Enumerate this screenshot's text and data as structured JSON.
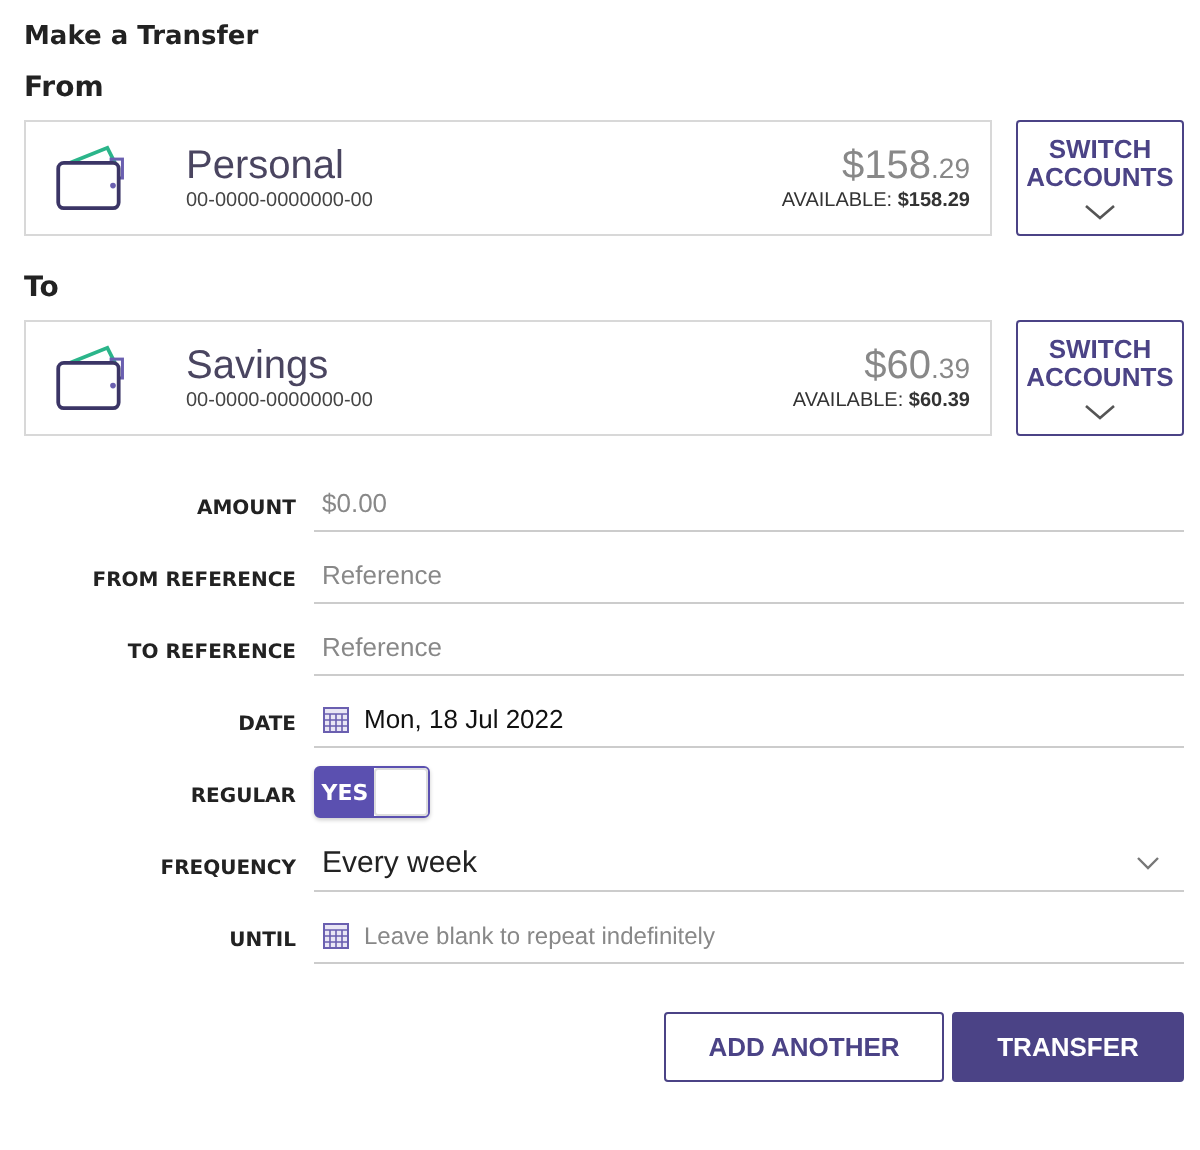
{
  "title": "Make a Transfer",
  "accounts": [
    {
      "heading": "From",
      "name": "Personal",
      "number": "00-0000-0000000-00",
      "dollars": "$158",
      "cents": ".29",
      "available": "AVAILABLE: **$158.29**",
      "button": "SWITCH ACCOUNTS"
    },
    {
      "heading": "To",
      "name": "Savings",
      "number": "00-0000-0000000-00",
      "dollars": "$60",
      "cents": ".39",
      "available": "AVAILABLE: **$60.39**",
      "button": "SWITCH ACCOUNTS"
    }
  ],
  "fields": [
    {
      "kind": "text",
      "label": "AMOUNT",
      "placeholder": "$0.00"
    },
    {
      "kind": "text",
      "label": "FROM REFERENCE",
      "placeholder": "Reference"
    },
    {
      "kind": "text",
      "label": "TO REFERENCE",
      "placeholder": "Reference"
    },
    {
      "kind": "date",
      "label": "DATE",
      "value": "Mon, 18 Jul 2022"
    },
    {
      "kind": "toggle",
      "label": "REGULAR",
      "on": true,
      "text": "YES"
    },
    {
      "kind": "select",
      "label": "FREQUENCY",
      "value": "Every week"
    },
    {
      "kind": "date",
      "label": "UNTIL",
      "placeholder": "Leave blank to repeat indefinitely"
    }
  ],
  "buttons": [
    {
      "label": "ADD ANOTHER",
      "kind": "secondary"
    },
    {
      "label": "TRANSFER",
      "kind": "primary"
    }
  ]
}
